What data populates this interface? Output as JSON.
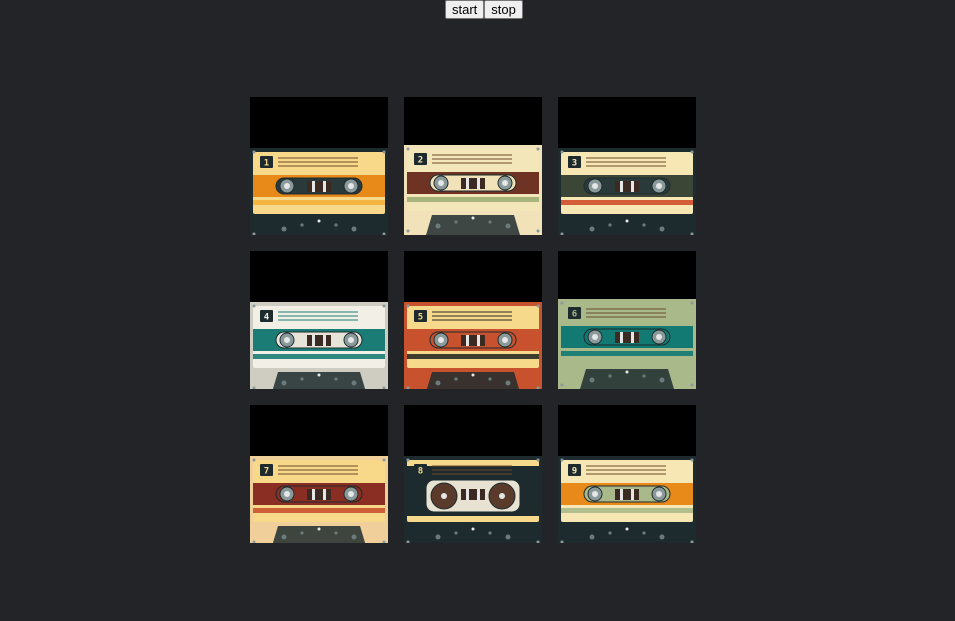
{
  "controls": {
    "start_label": "start",
    "stop_label": "stop"
  },
  "tiles": [
    {
      "number": "1",
      "label_bg": "#f8d98a",
      "stripe": "#e88a1a",
      "stripe2": "#f4b03a",
      "window": "#2a3a3a",
      "body": "#1e2b2e",
      "lines": "#6b4a2a"
    },
    {
      "number": "2",
      "label_bg": "#f3e6b8",
      "stripe": "#6e3322",
      "stripe2": "#9fae74",
      "window": "#f1e2b9",
      "body": "#f1e2b9",
      "lines": "#6b4a2a"
    },
    {
      "number": "3",
      "label_bg": "#f6e7b4",
      "stripe": "#3b4636",
      "stripe2": "#d24d2a",
      "window": "#2a3a3a",
      "body": "#1e2b2e",
      "lines": "#6b4a2a"
    },
    {
      "number": "4",
      "label_bg": "#f1efe6",
      "stripe": "#1a7c74",
      "stripe2": "#1a7c74",
      "window": "#e6e3d8",
      "body": "#cfccc2",
      "lines": "#1a7c74"
    },
    {
      "number": "5",
      "label_bg": "#f6d98a",
      "stripe": "#c8522e",
      "stripe2": "#2a2a22",
      "window": "#c8522e",
      "body": "#c8522e",
      "lines": "#2a2a22"
    },
    {
      "number": "6",
      "label_bg": "#a9b98a",
      "stripe": "#127a72",
      "stripe2": "#127a72",
      "window": "#127a72",
      "body": "#a9b98a",
      "lines": "#6b4a2a"
    },
    {
      "number": "7",
      "label_bg": "#f8d98a",
      "stripe": "#8a2d22",
      "stripe2": "#c8522e",
      "window": "#8a2d22",
      "body": "#f1cf9a",
      "lines": "#6b4a2a"
    },
    {
      "number": "8",
      "label_bg": "#f6d98a",
      "stripe": "#1e2b2e",
      "stripe2": "#1e2b2e",
      "window": "#e7e2d2",
      "body": "#1e2b2e",
      "lines": "#6b4a2a"
    },
    {
      "number": "9",
      "label_bg": "#f6e7b4",
      "stripe": "#e88a1a",
      "stripe2": "#a9b98a",
      "window": "#a9b98a",
      "body": "#1e2b2e",
      "lines": "#6b4a2a"
    }
  ]
}
